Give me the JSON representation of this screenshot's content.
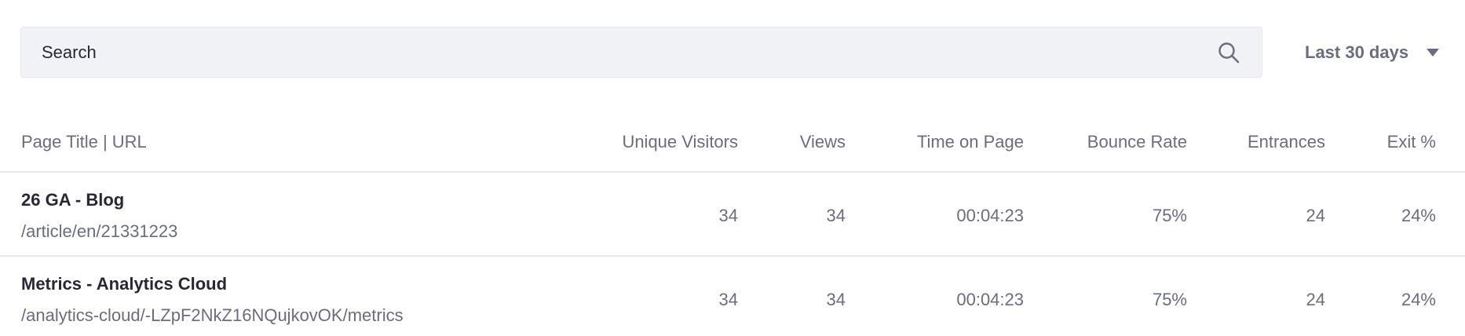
{
  "toolbar": {
    "search_placeholder": "Search",
    "search_icon": "search-icon",
    "date_range": "Last 30 days",
    "date_caret_icon": "caret-down-icon"
  },
  "table": {
    "columns": [
      "Page Title | URL",
      "Unique Visitors",
      "Views",
      "Time on Page",
      "Bounce Rate",
      "Entrances",
      "Exit %"
    ],
    "rows": [
      {
        "title": "26 GA - Blog",
        "url": "/article/en/21331223",
        "unique_visitors": "34",
        "views": "34",
        "time_on_page": "00:04:23",
        "bounce_rate": "75%",
        "entrances": "24",
        "exit": "24%"
      },
      {
        "title": "Metrics - Analytics Cloud",
        "url": "/analytics-cloud/-LZpF2NkZ16NQujkovOK/metrics",
        "unique_visitors": "34",
        "views": "34",
        "time_on_page": "00:04:23",
        "bounce_rate": "75%",
        "entrances": "24",
        "exit": "24%"
      }
    ]
  },
  "colors": {
    "text_primary": "#272833",
    "text_secondary": "#6b6c7e",
    "input_bg": "#f1f2f5",
    "border": "#e7e7ed"
  }
}
